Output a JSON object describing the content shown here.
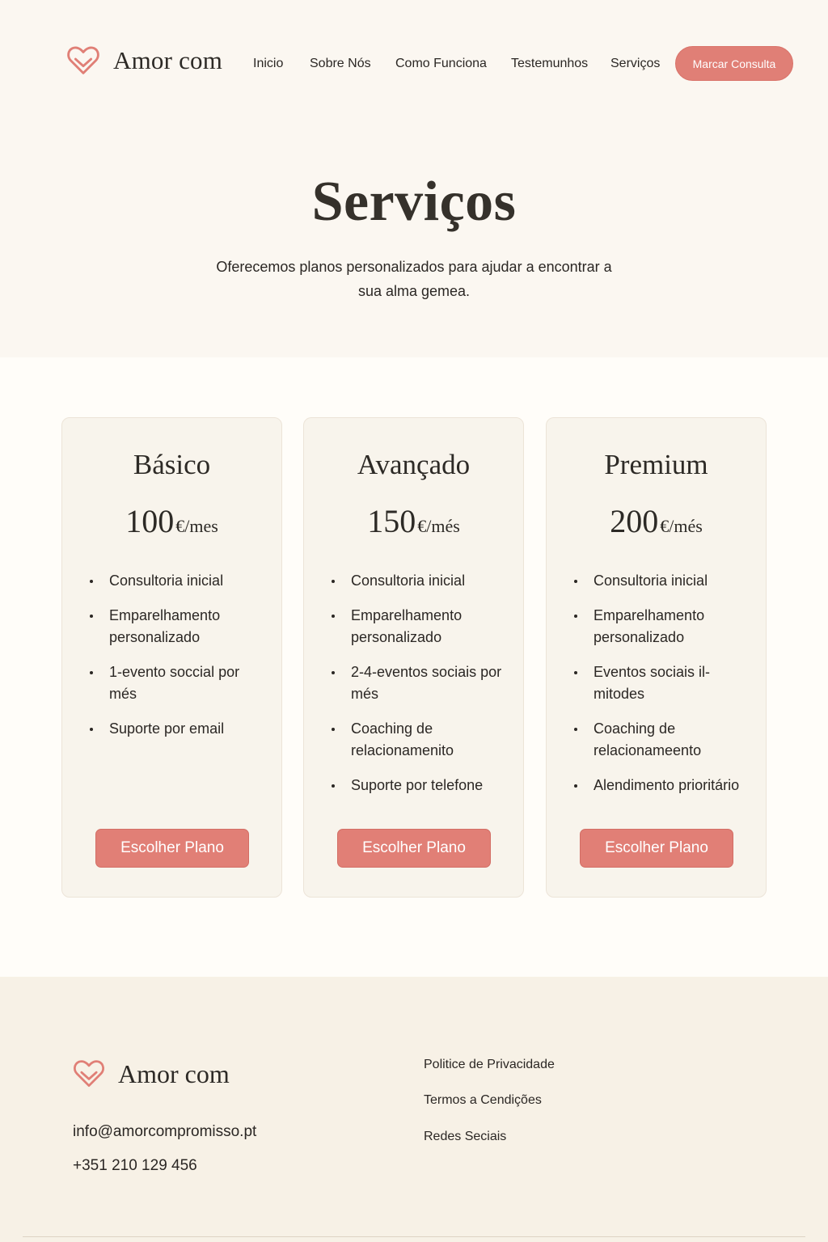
{
  "brand": {
    "name": "Amor com",
    "accent": "#e07f76"
  },
  "header": {
    "nav": [
      "Inicio",
      "Sobre Nós",
      "Como Funciona",
      "Testemunhos",
      "Serviços"
    ],
    "cta_label": "Marcar Consulta"
  },
  "hero": {
    "title": "Serviços",
    "subtitle": "Oferecemos planos personalizados para ajudar a encontrar a sua alma gemea."
  },
  "plans": [
    {
      "name": "Básico",
      "price": "100",
      "unit": "€/mes",
      "features": [
        "Consultoria inicial",
        "Emparelhamento personalizado",
        "1-evento soccial por més",
        "Suporte por email"
      ],
      "button": "Escolher Plano"
    },
    {
      "name": "Avançado",
      "price": "150",
      "unit": "€/més",
      "features": [
        "Consultoria inicial",
        "Emparelhamento personalizado",
        "2-4-eventos sociais por més",
        "Coaching de relacionamenito",
        "Suporte por telefone"
      ],
      "button": "Escolher Plano"
    },
    {
      "name": "Premium",
      "price": "200",
      "unit": "€/més",
      "features": [
        "Consultoria inicial",
        "Emparelhamento personalizado",
        "Eventos sociais il-mitodes",
        "Coaching de relacionameento",
        "Alendimento prioritário"
      ],
      "button": "Escolher Plano"
    }
  ],
  "footer": {
    "brand": "Amor com",
    "email": "info@amorcompromisso.pt",
    "phone": "+351 210 129 456",
    "links": [
      "Politice de Privacidade",
      "Termos a Cendições",
      "Redes Seciais"
    ]
  }
}
